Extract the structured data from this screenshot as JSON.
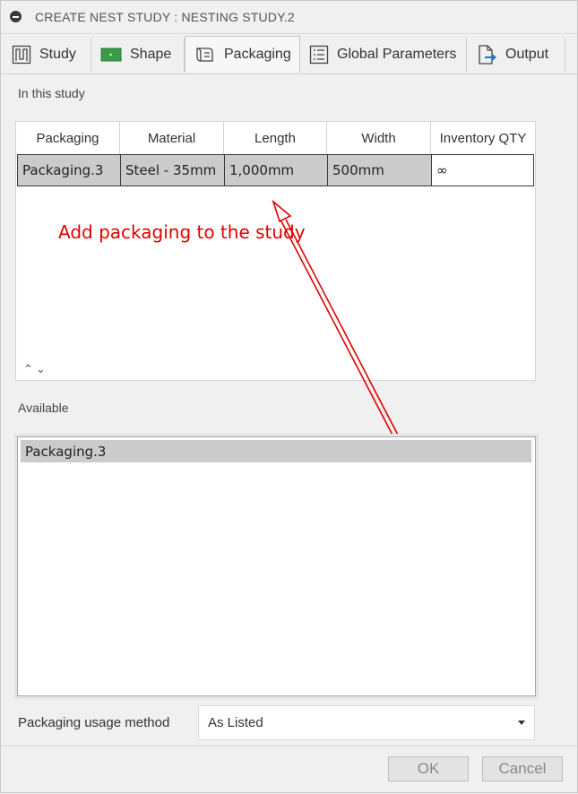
{
  "dialog": {
    "title": "CREATE NEST STUDY : NESTING STUDY.2"
  },
  "tabs": [
    {
      "label": "Study",
      "icon": "study-icon"
    },
    {
      "label": "Shape",
      "icon": "shape-icon"
    },
    {
      "label": "Packaging",
      "icon": "packaging-icon",
      "active": true
    },
    {
      "label": "Global Parameters",
      "icon": "list-icon"
    },
    {
      "label": "Output",
      "icon": "output-icon"
    }
  ],
  "study": {
    "label": "In this study",
    "columns": [
      "Packaging",
      "Material",
      "Length",
      "Width",
      "Inventory QTY"
    ],
    "rows": [
      [
        "Packaging.3",
        "Steel - 35mm",
        "1,000mm",
        "500mm",
        "∞"
      ]
    ],
    "sort_arrows": "⌃⌄"
  },
  "annotation": {
    "text": "Add packaging to the study",
    "color": "#e00000"
  },
  "available": {
    "label": "Available",
    "items": [
      "Packaging.3"
    ]
  },
  "usage": {
    "label": "Packaging usage method",
    "value": "As Listed"
  },
  "buttons": {
    "ok": "OK",
    "cancel": "Cancel"
  }
}
